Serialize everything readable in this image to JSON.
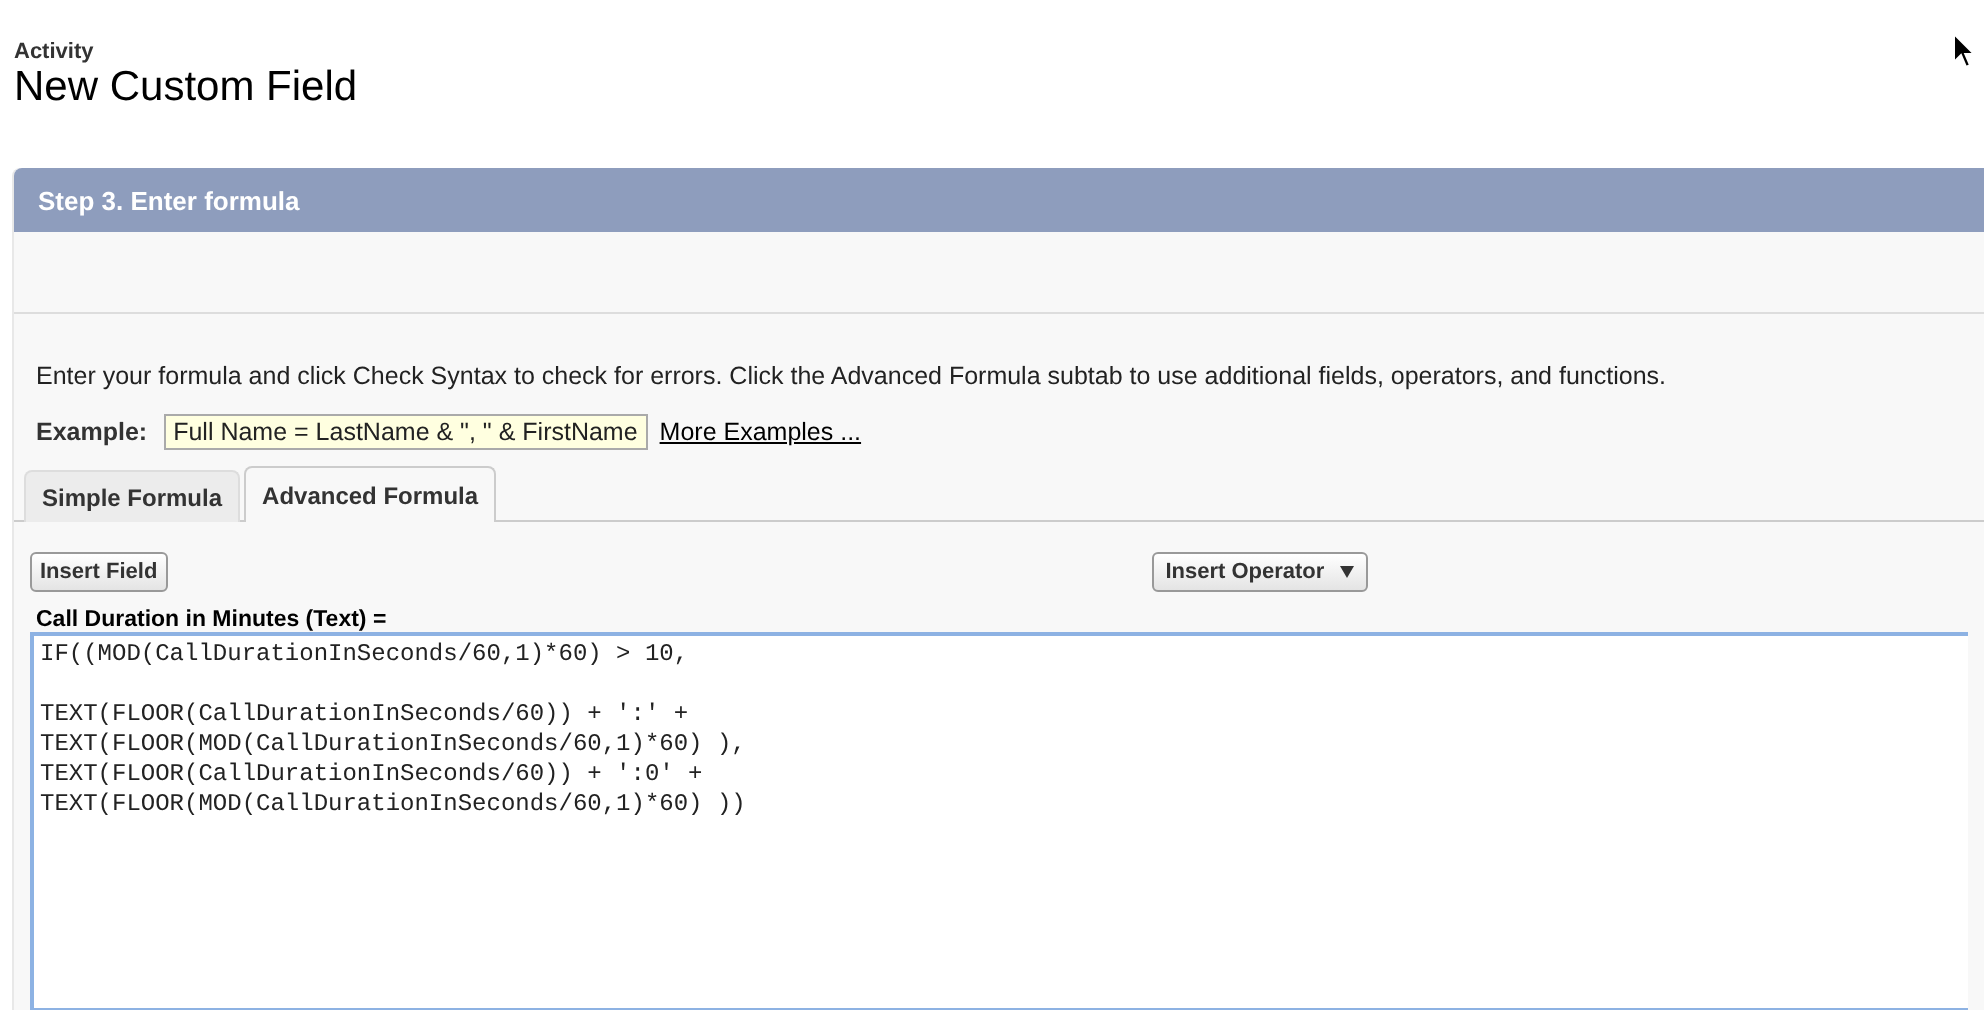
{
  "header": {
    "object": "Activity",
    "title": "New Custom Field"
  },
  "step": {
    "title": "Step 3. Enter formula"
  },
  "instructions": "Enter your formula and click Check Syntax to check for errors. Click the Advanced Formula subtab to use additional fields, operators, and functions.",
  "example": {
    "label": "Example:",
    "value": "Full Name = LastName & \", \" & FirstName",
    "link": "More Examples ..."
  },
  "tabs": [
    {
      "label": "Simple Formula",
      "selected": false
    },
    {
      "label": "Advanced Formula",
      "selected": true
    }
  ],
  "toolbar": [
    {
      "label": "Insert Field",
      "kind": "button"
    },
    {
      "label": "Insert Operator",
      "kind": "dropdown"
    }
  ],
  "formula": {
    "label": "Call Duration in Minutes (Text) =",
    "value": "IF((MOD(CallDurationInSeconds/60,1)*60) > 10,\n\nTEXT(FLOOR(CallDurationInSeconds/60)) + ':' +\nTEXT(FLOOR(MOD(CallDurationInSeconds/60,1)*60) ),\nTEXT(FLOOR(CallDurationInSeconds/60)) + ':0' +\nTEXT(FLOOR(MOD(CallDurationInSeconds/60,1)*60) ))"
  }
}
